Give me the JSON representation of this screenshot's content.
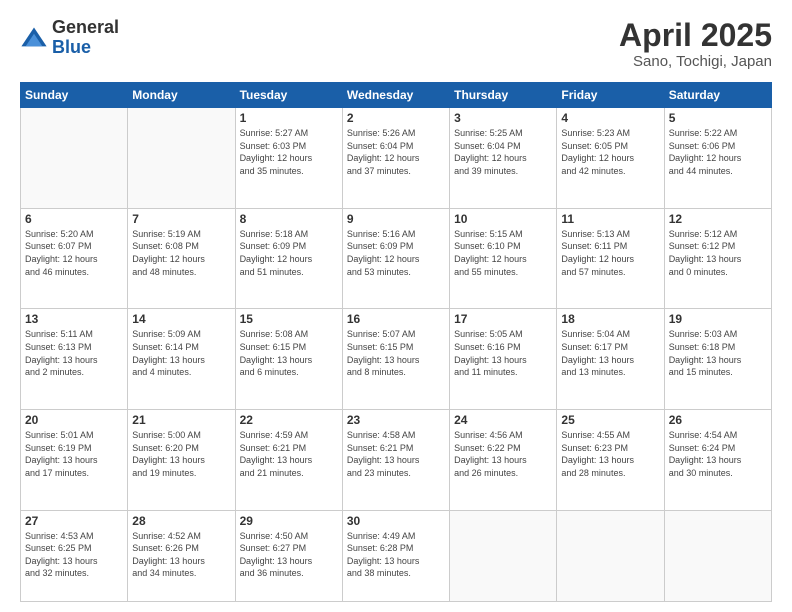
{
  "header": {
    "logo_general": "General",
    "logo_blue": "Blue",
    "title": "April 2025",
    "location": "Sano, Tochigi, Japan"
  },
  "weekdays": [
    "Sunday",
    "Monday",
    "Tuesday",
    "Wednesday",
    "Thursday",
    "Friday",
    "Saturday"
  ],
  "weeks": [
    [
      {
        "day": "",
        "detail": ""
      },
      {
        "day": "",
        "detail": ""
      },
      {
        "day": "1",
        "detail": "Sunrise: 5:27 AM\nSunset: 6:03 PM\nDaylight: 12 hours\nand 35 minutes."
      },
      {
        "day": "2",
        "detail": "Sunrise: 5:26 AM\nSunset: 6:04 PM\nDaylight: 12 hours\nand 37 minutes."
      },
      {
        "day": "3",
        "detail": "Sunrise: 5:25 AM\nSunset: 6:04 PM\nDaylight: 12 hours\nand 39 minutes."
      },
      {
        "day": "4",
        "detail": "Sunrise: 5:23 AM\nSunset: 6:05 PM\nDaylight: 12 hours\nand 42 minutes."
      },
      {
        "day": "5",
        "detail": "Sunrise: 5:22 AM\nSunset: 6:06 PM\nDaylight: 12 hours\nand 44 minutes."
      }
    ],
    [
      {
        "day": "6",
        "detail": "Sunrise: 5:20 AM\nSunset: 6:07 PM\nDaylight: 12 hours\nand 46 minutes."
      },
      {
        "day": "7",
        "detail": "Sunrise: 5:19 AM\nSunset: 6:08 PM\nDaylight: 12 hours\nand 48 minutes."
      },
      {
        "day": "8",
        "detail": "Sunrise: 5:18 AM\nSunset: 6:09 PM\nDaylight: 12 hours\nand 51 minutes."
      },
      {
        "day": "9",
        "detail": "Sunrise: 5:16 AM\nSunset: 6:09 PM\nDaylight: 12 hours\nand 53 minutes."
      },
      {
        "day": "10",
        "detail": "Sunrise: 5:15 AM\nSunset: 6:10 PM\nDaylight: 12 hours\nand 55 minutes."
      },
      {
        "day": "11",
        "detail": "Sunrise: 5:13 AM\nSunset: 6:11 PM\nDaylight: 12 hours\nand 57 minutes."
      },
      {
        "day": "12",
        "detail": "Sunrise: 5:12 AM\nSunset: 6:12 PM\nDaylight: 13 hours\nand 0 minutes."
      }
    ],
    [
      {
        "day": "13",
        "detail": "Sunrise: 5:11 AM\nSunset: 6:13 PM\nDaylight: 13 hours\nand 2 minutes."
      },
      {
        "day": "14",
        "detail": "Sunrise: 5:09 AM\nSunset: 6:14 PM\nDaylight: 13 hours\nand 4 minutes."
      },
      {
        "day": "15",
        "detail": "Sunrise: 5:08 AM\nSunset: 6:15 PM\nDaylight: 13 hours\nand 6 minutes."
      },
      {
        "day": "16",
        "detail": "Sunrise: 5:07 AM\nSunset: 6:15 PM\nDaylight: 13 hours\nand 8 minutes."
      },
      {
        "day": "17",
        "detail": "Sunrise: 5:05 AM\nSunset: 6:16 PM\nDaylight: 13 hours\nand 11 minutes."
      },
      {
        "day": "18",
        "detail": "Sunrise: 5:04 AM\nSunset: 6:17 PM\nDaylight: 13 hours\nand 13 minutes."
      },
      {
        "day": "19",
        "detail": "Sunrise: 5:03 AM\nSunset: 6:18 PM\nDaylight: 13 hours\nand 15 minutes."
      }
    ],
    [
      {
        "day": "20",
        "detail": "Sunrise: 5:01 AM\nSunset: 6:19 PM\nDaylight: 13 hours\nand 17 minutes."
      },
      {
        "day": "21",
        "detail": "Sunrise: 5:00 AM\nSunset: 6:20 PM\nDaylight: 13 hours\nand 19 minutes."
      },
      {
        "day": "22",
        "detail": "Sunrise: 4:59 AM\nSunset: 6:21 PM\nDaylight: 13 hours\nand 21 minutes."
      },
      {
        "day": "23",
        "detail": "Sunrise: 4:58 AM\nSunset: 6:21 PM\nDaylight: 13 hours\nand 23 minutes."
      },
      {
        "day": "24",
        "detail": "Sunrise: 4:56 AM\nSunset: 6:22 PM\nDaylight: 13 hours\nand 26 minutes."
      },
      {
        "day": "25",
        "detail": "Sunrise: 4:55 AM\nSunset: 6:23 PM\nDaylight: 13 hours\nand 28 minutes."
      },
      {
        "day": "26",
        "detail": "Sunrise: 4:54 AM\nSunset: 6:24 PM\nDaylight: 13 hours\nand 30 minutes."
      }
    ],
    [
      {
        "day": "27",
        "detail": "Sunrise: 4:53 AM\nSunset: 6:25 PM\nDaylight: 13 hours\nand 32 minutes."
      },
      {
        "day": "28",
        "detail": "Sunrise: 4:52 AM\nSunset: 6:26 PM\nDaylight: 13 hours\nand 34 minutes."
      },
      {
        "day": "29",
        "detail": "Sunrise: 4:50 AM\nSunset: 6:27 PM\nDaylight: 13 hours\nand 36 minutes."
      },
      {
        "day": "30",
        "detail": "Sunrise: 4:49 AM\nSunset: 6:28 PM\nDaylight: 13 hours\nand 38 minutes."
      },
      {
        "day": "",
        "detail": ""
      },
      {
        "day": "",
        "detail": ""
      },
      {
        "day": "",
        "detail": ""
      }
    ]
  ]
}
